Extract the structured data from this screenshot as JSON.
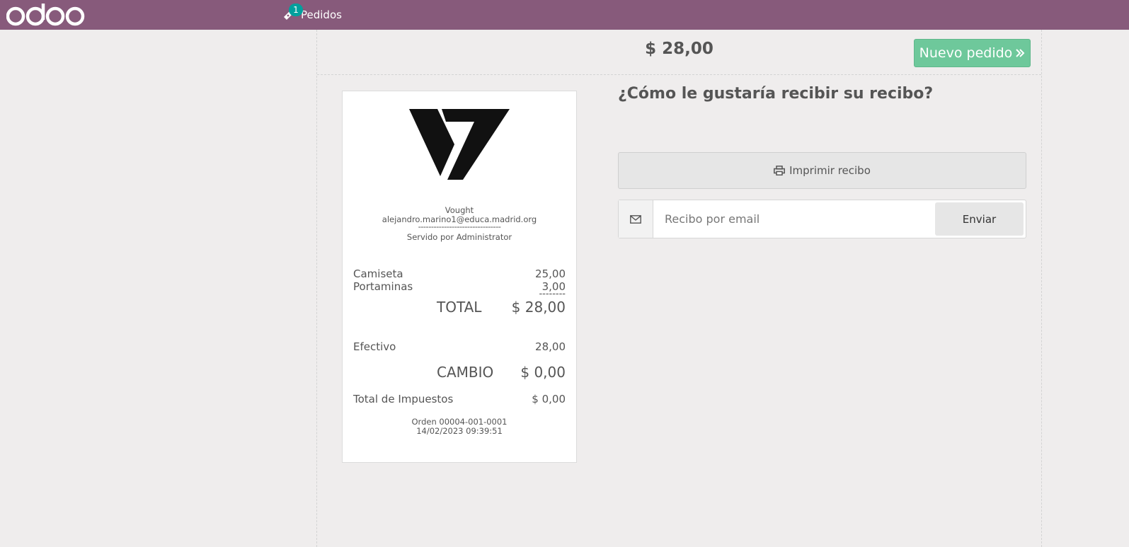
{
  "topbar": {
    "logo_text": "odoo",
    "orders": {
      "badge": "1",
      "label": "Pedidos"
    }
  },
  "header": {
    "total": "$ 28,00",
    "new_order_label": "Nuevo pedido"
  },
  "receipt": {
    "company": "Vought",
    "email": "alejandro.marino1@educa.madrid.org",
    "separator": "--------------------------------",
    "served_by": "Servido por Administrator",
    "lines": [
      {
        "name": "Camiseta",
        "price": "25,00"
      },
      {
        "name": "Portaminas",
        "price": "3,00"
      }
    ],
    "subtotal_separator": "--------",
    "total_label": "TOTAL",
    "total_value": "$ 28,00",
    "payment_label": "Efectivo",
    "payment_value": "28,00",
    "change_label": "CAMBIO",
    "change_value": "$ 0,00",
    "taxes_label": "Total de Impuestos",
    "taxes_value": "$ 0,00",
    "order_ref": "Orden 00004-001-0001",
    "datetime": "14/02/2023 09:39:51"
  },
  "actions": {
    "question": "¿Cómo le gustaría recibir su recibo?",
    "print_label": "Imprimir recibo",
    "email_placeholder": "Recibo por email",
    "email_value": "",
    "send_label": "Enviar"
  },
  "colors": {
    "topbar": "#875a7b",
    "new_order": "#6ec89b",
    "badge": "#00a09d",
    "background": "#efeded"
  },
  "icons": [
    "odoo-logo",
    "ticket-icon",
    "double-chevron-right-icon",
    "printer-icon",
    "envelope-icon",
    "company-logo"
  ]
}
